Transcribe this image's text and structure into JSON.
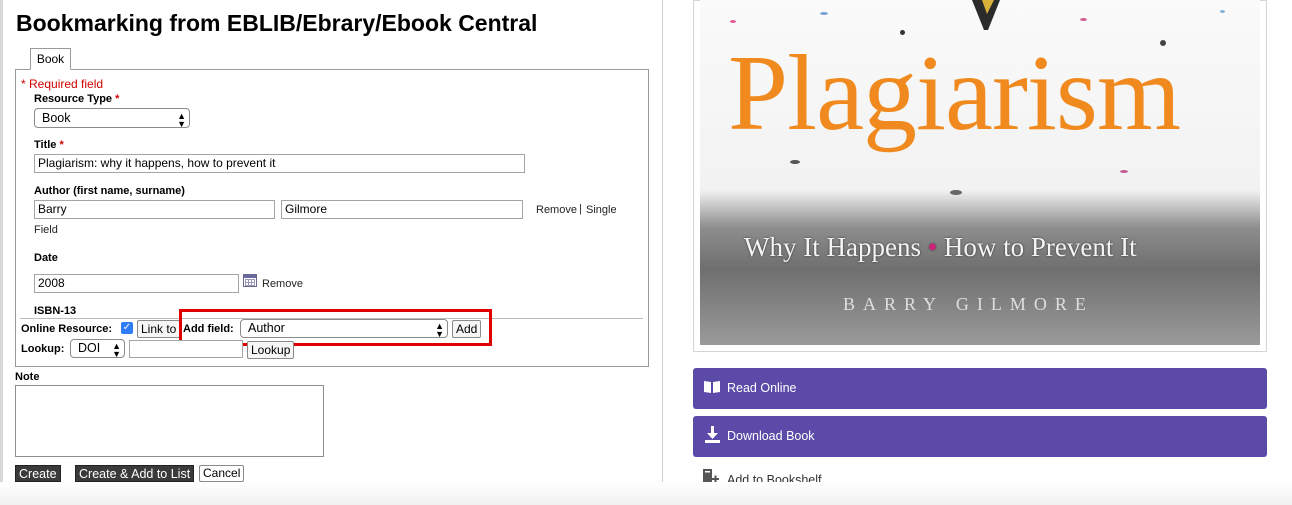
{
  "page": {
    "title": "Bookmarking from EBLIB/Ebrary/Ebook Central"
  },
  "tabs": [
    {
      "label": "Book"
    }
  ],
  "form": {
    "required_note": "* Required field",
    "required_mark": "*",
    "resource_type": {
      "label": "Resource Type",
      "value": "Book"
    },
    "title": {
      "label": "Title",
      "value": "Plagiarism: why it happens, how to prevent it"
    },
    "author": {
      "label": "Author (first name, surname)",
      "first_name": "Barry",
      "surname": "Gilmore",
      "remove_label": "Remove",
      "separator": "|",
      "single_field_label_1": "Single",
      "single_field_label_2": "Field"
    },
    "date": {
      "label": "Date",
      "value": "2008",
      "remove_label": "Remove"
    },
    "isbn": {
      "label": "ISBN-13"
    },
    "online_resource": {
      "label": "Online Resource:",
      "checked": true,
      "link_label": "Link to"
    },
    "add_field": {
      "label": "Add field:",
      "value": "Author",
      "button": "Add"
    },
    "lookup": {
      "label": "Lookup:",
      "type": "DOI",
      "value": "",
      "button": "Lookup"
    },
    "note": {
      "label": "Note",
      "value": ""
    },
    "buttons": {
      "create": "Create",
      "create_add_list": "Create & Add to List",
      "cancel": "Cancel"
    }
  },
  "book_cover": {
    "title": "Plagiarism",
    "subtitle_part1": "Why It Happens",
    "subtitle_separator": "•",
    "subtitle_part2": "How to Prevent It",
    "author": "BARRY GILMORE"
  },
  "actions": {
    "read_online": {
      "label": "Read Online",
      "icon": "open-book-icon"
    },
    "download_book": {
      "label": "Download Book",
      "icon": "download-icon"
    },
    "add_to_bookshelf": {
      "label": "Add to Bookshelf",
      "icon": "bookshelf-add-icon"
    }
  },
  "colors": {
    "accent": "#5b4aa8",
    "required": "#d00000",
    "highlight": "#e00000",
    "cover_title": "#f08a1e"
  }
}
